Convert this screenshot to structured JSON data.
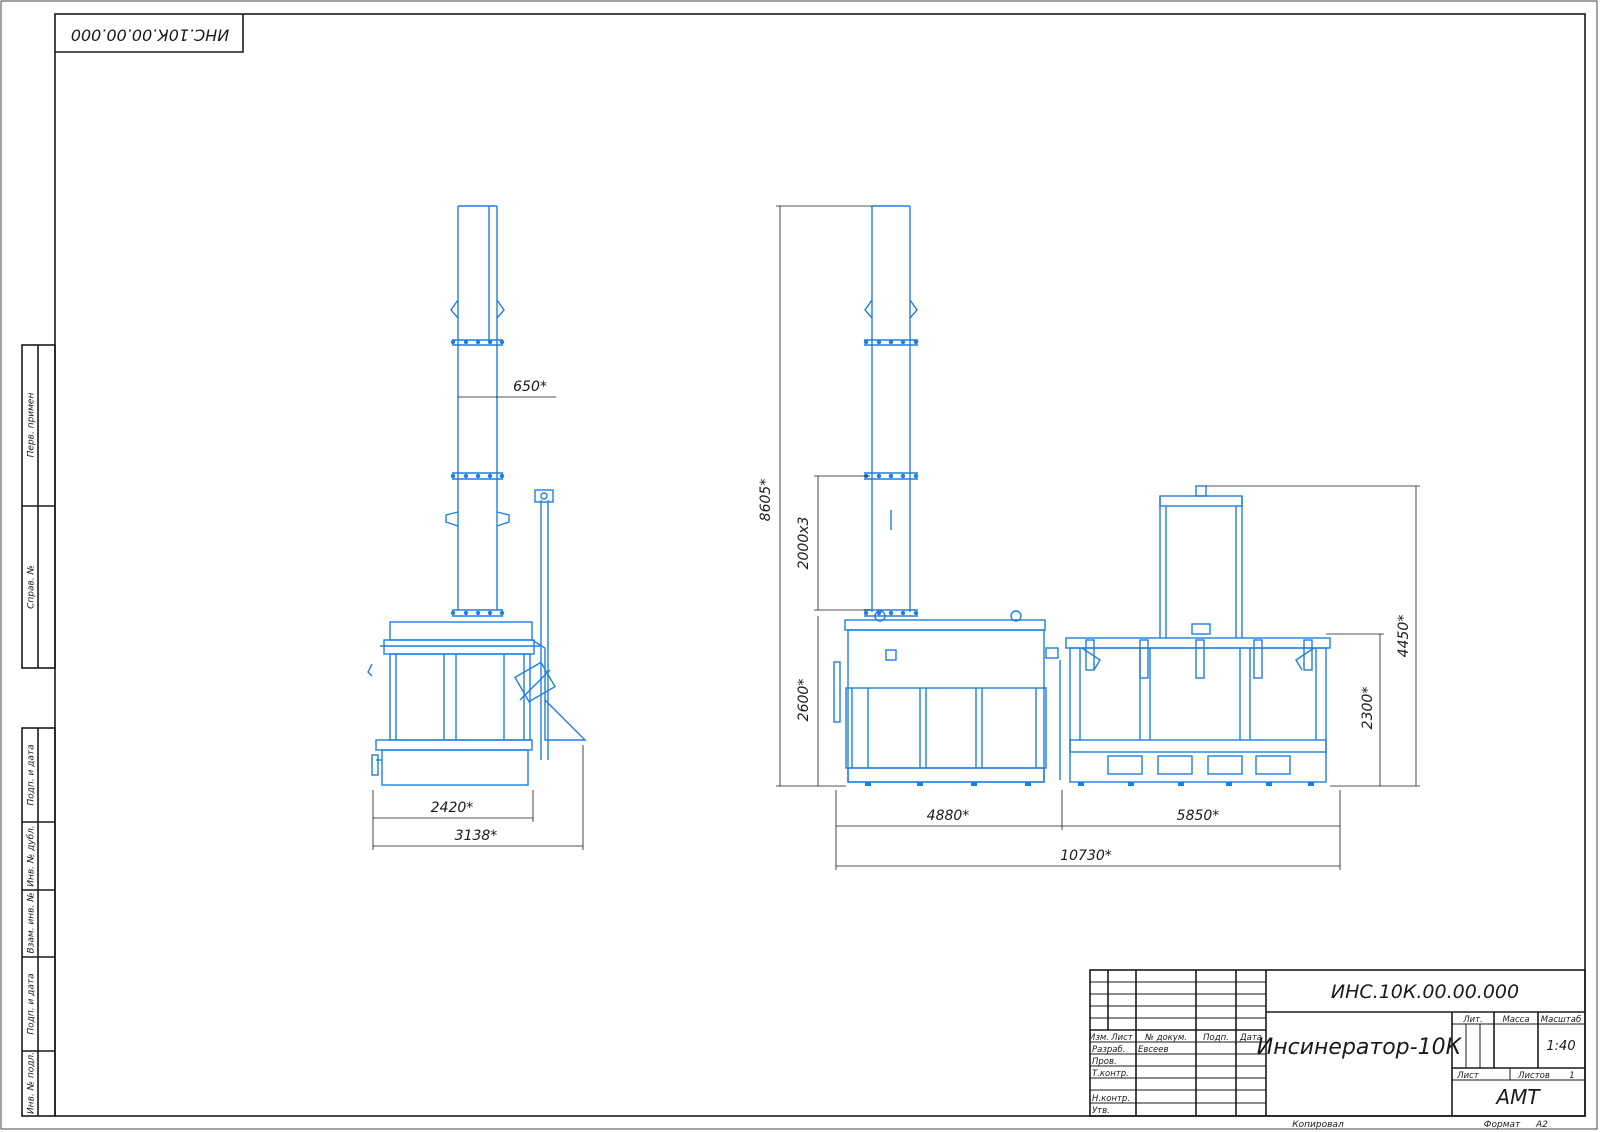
{
  "drawing_number": "ИНС.10К.00.00.000",
  "drawing_number_mirrored": "ИНС.10К.00.00.000",
  "side_stamp": {
    "perv_primen": "Перв. примен",
    "sprav_no": "Справ. №",
    "podp_data_1": "Подп. и дата",
    "inv_dubl": "Инв. № дубл.",
    "vzam_inv": "Взам. инв. №",
    "podp_data_2": "Подп. и дата",
    "inv_podl": "Инв. № подл."
  },
  "dimensions": {
    "chimney_diameter": "650*",
    "left_width_inner": "2420*",
    "left_width_total": "3138*",
    "total_height": "8605*",
    "chimney_section": "2000х3",
    "body_height_1": "2600*",
    "body_height_2": "2300*",
    "frame_height": "4450*",
    "length_1": "4880*",
    "length_2": "5850*",
    "length_total": "10730*"
  },
  "title_block": {
    "number": "ИНС.10К.00.00.000",
    "name": "Инсинератор-10К",
    "col_izm": "Изм.",
    "col_list": "Лист",
    "col_dokum": "№ докум.",
    "col_podp": "Подп.",
    "col_data": "Дата",
    "row_razrab": "Разраб.",
    "razrab_name": "Евсеев",
    "row_prov": "Пров.",
    "row_tkontr": "Т.контр.",
    "row_nkontr": "Н.контр.",
    "row_utv": "Утв.",
    "lit_label": "Лит.",
    "massa_label": "Масса",
    "masshtab_label": "Масштаб",
    "scale": "1:40",
    "sheet_label": "Лист",
    "sheets_label": "Листов",
    "sheets_count": "1",
    "organization": "АМТ",
    "copied_label": "Копировал",
    "format_label": "Формат",
    "format_value": "A2"
  }
}
